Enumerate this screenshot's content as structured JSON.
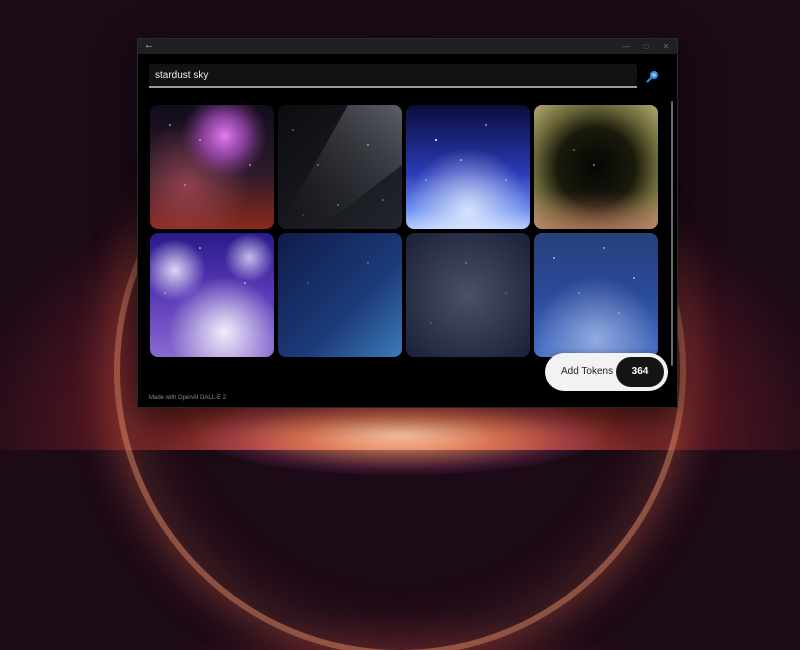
{
  "search": {
    "query": "stardust sky"
  },
  "titlebar": {
    "back_icon": "back-arrow-icon"
  },
  "results": {
    "tiles": [
      "nebula-pink-red",
      "milky-way-grey",
      "blue-sky-horizon",
      "golden-dust-cloud",
      "purple-clouds",
      "blue-gradient",
      "grey-blue-gradient",
      "blue-starry-clouds"
    ]
  },
  "footer": {
    "credit": "Made with OpenAI DALL-E 2"
  },
  "tokens": {
    "label": "Add Tokens",
    "count": "364"
  },
  "colors": {
    "accent": "#2f8fd9",
    "tokens_pill": "#f2f2f2",
    "count_pill": "#141414"
  }
}
